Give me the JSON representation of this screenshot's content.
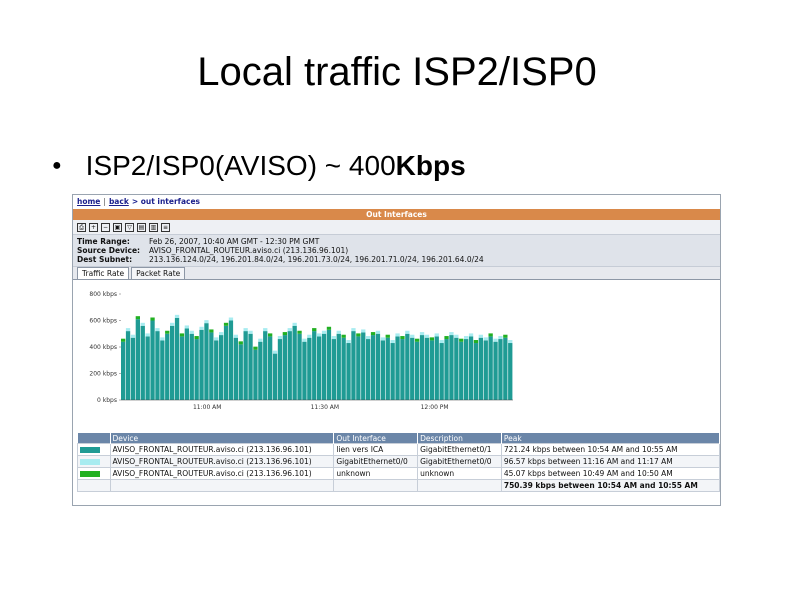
{
  "slide": {
    "title": "Local traffic ISP2/ISP0",
    "bullet_prefix": "ISP2/ISP0(AVISO)  ~ 400",
    "bullet_unit": "Kbps"
  },
  "screenshot": {
    "nav": {
      "home": "home",
      "sep": "|",
      "back": "back",
      "crumb": "> out interfaces"
    },
    "title": "Out Interfaces",
    "meta": [
      {
        "label": "Time Range:",
        "value": "Feb 26, 2007, 10:40 AM GMT - 12:30 PM GMT"
      },
      {
        "label": "Source Device:",
        "value": "AVISO_FRONTAL_ROUTEUR.aviso.ci (213.136.96.101)"
      },
      {
        "label": "Dest Subnet:",
        "value": "213.136.124.0/24, 196.201.84.0/24, 196.201.73.0/24, 196.201.71.0/24, 196.201.64.0/24"
      }
    ],
    "tabs": [
      {
        "label": "Traffic Rate",
        "active": true
      },
      {
        "label": "Packet Rate",
        "active": false
      }
    ],
    "table": {
      "headers": [
        "Device",
        "Out Interface",
        "Description",
        "Peak"
      ],
      "rows": [
        {
          "color": "#1f9b94",
          "device": "AVISO_FRONTAL_ROUTEUR.aviso.ci (213.136.96.101)",
          "iface": "lien vers ICA",
          "desc": "GigabitEthernet0/1",
          "peak": "721.24 kbps between 10:54 AM and 10:55 AM"
        },
        {
          "color": "#a8ecf0",
          "device": "AVISO_FRONTAL_ROUTEUR.aviso.ci (213.136.96.101)",
          "iface": "GigabitEthernet0/0",
          "desc": "GigabitEthernet0/0",
          "peak": "96.57 kbps between 11:16 AM and 11:17 AM"
        },
        {
          "color": "#22b022",
          "device": "AVISO_FRONTAL_ROUTEUR.aviso.ci (213.136.96.101)",
          "iface": "unknown",
          "desc": "unknown",
          "peak": "45.07 kbps between 10:49 AM and 10:50 AM"
        }
      ],
      "total": "750.39 kbps between 10:54 AM and 10:55 AM"
    }
  },
  "chart_data": {
    "type": "bar",
    "ylabel_unit": "kbps",
    "y_ticks": [
      "0 kbps",
      "200 kbps",
      "400 kbps",
      "600 kbps",
      "800 kbps"
    ],
    "ylim": [
      0,
      800
    ],
    "x_ticks": [
      "11:00 AM",
      "11:30 AM",
      "12:00 PM"
    ],
    "colors": {
      "main": "#1f9b94",
      "top": "#a8ecf0",
      "other": "#22b022"
    },
    "series": [
      {
        "values": [
          440,
          520,
          470,
          610,
          560,
          480,
          600,
          520,
          450,
          500,
          560,
          620,
          480,
          540,
          500,
          460,
          530,
          580,
          510,
          450,
          490,
          560,
          600,
          470,
          420,
          520,
          500,
          380,
          440,
          520,
          480,
          350,
          460,
          490,
          520,
          560,
          500,
          440,
          470,
          520,
          480,
          500,
          530,
          460,
          500,
          470,
          430,
          520,
          480,
          510,
          460,
          490,
          500,
          450,
          470,
          430,
          480,
          460,
          500,
          470,
          440,
          490,
          470,
          450,
          480,
          430,
          460,
          490,
          470,
          440,
          460,
          480,
          430,
          470,
          450,
          480,
          440,
          460,
          470,
          430
        ]
      }
    ]
  }
}
